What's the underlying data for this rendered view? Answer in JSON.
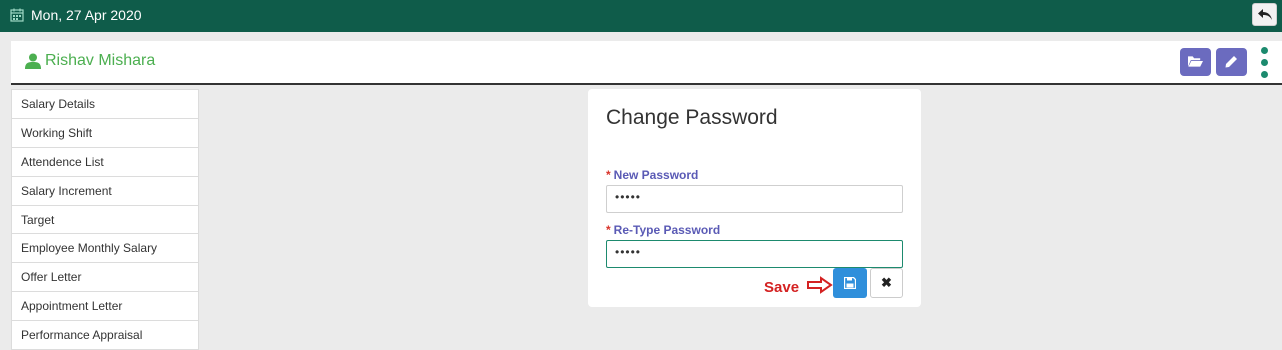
{
  "topbar": {
    "date": "Mon, 27 Apr 2020",
    "calendar_icon": "calendar-icon",
    "back_icon": "undo-arrow-icon"
  },
  "header": {
    "user_name": "Rishav Mishara",
    "user_icon": "user-icon",
    "buttons": [
      "folder-open-icon",
      "pencil-icon",
      "kebab-menu-icon"
    ]
  },
  "sidebar": {
    "items": [
      {
        "label": "Salary Details"
      },
      {
        "label": "Working Shift"
      },
      {
        "label": "Attendence List"
      },
      {
        "label": "Salary Increment"
      },
      {
        "label": "Target"
      },
      {
        "label": "Employee Monthly Salary"
      },
      {
        "label": "Offer Letter"
      },
      {
        "label": "Appointment Letter"
      },
      {
        "label": "Performance Appraisal"
      }
    ]
  },
  "form": {
    "title": "Change Password",
    "required_mark": "*",
    "new_password_label": "New Password",
    "new_password_value": "•••••",
    "retype_password_label": "Re-Type Password",
    "retype_password_value": "•••••",
    "save_icon": "floppy-disk-icon",
    "cancel_label": "✖"
  },
  "annotation": {
    "text": "Save",
    "color": "#d42222"
  },
  "colors": {
    "topbar": "#0f5c4a",
    "user_name": "#4caf50",
    "header_button": "#6b6bbf",
    "save_button": "#2f8fdb",
    "label": "#5a5ab5"
  }
}
